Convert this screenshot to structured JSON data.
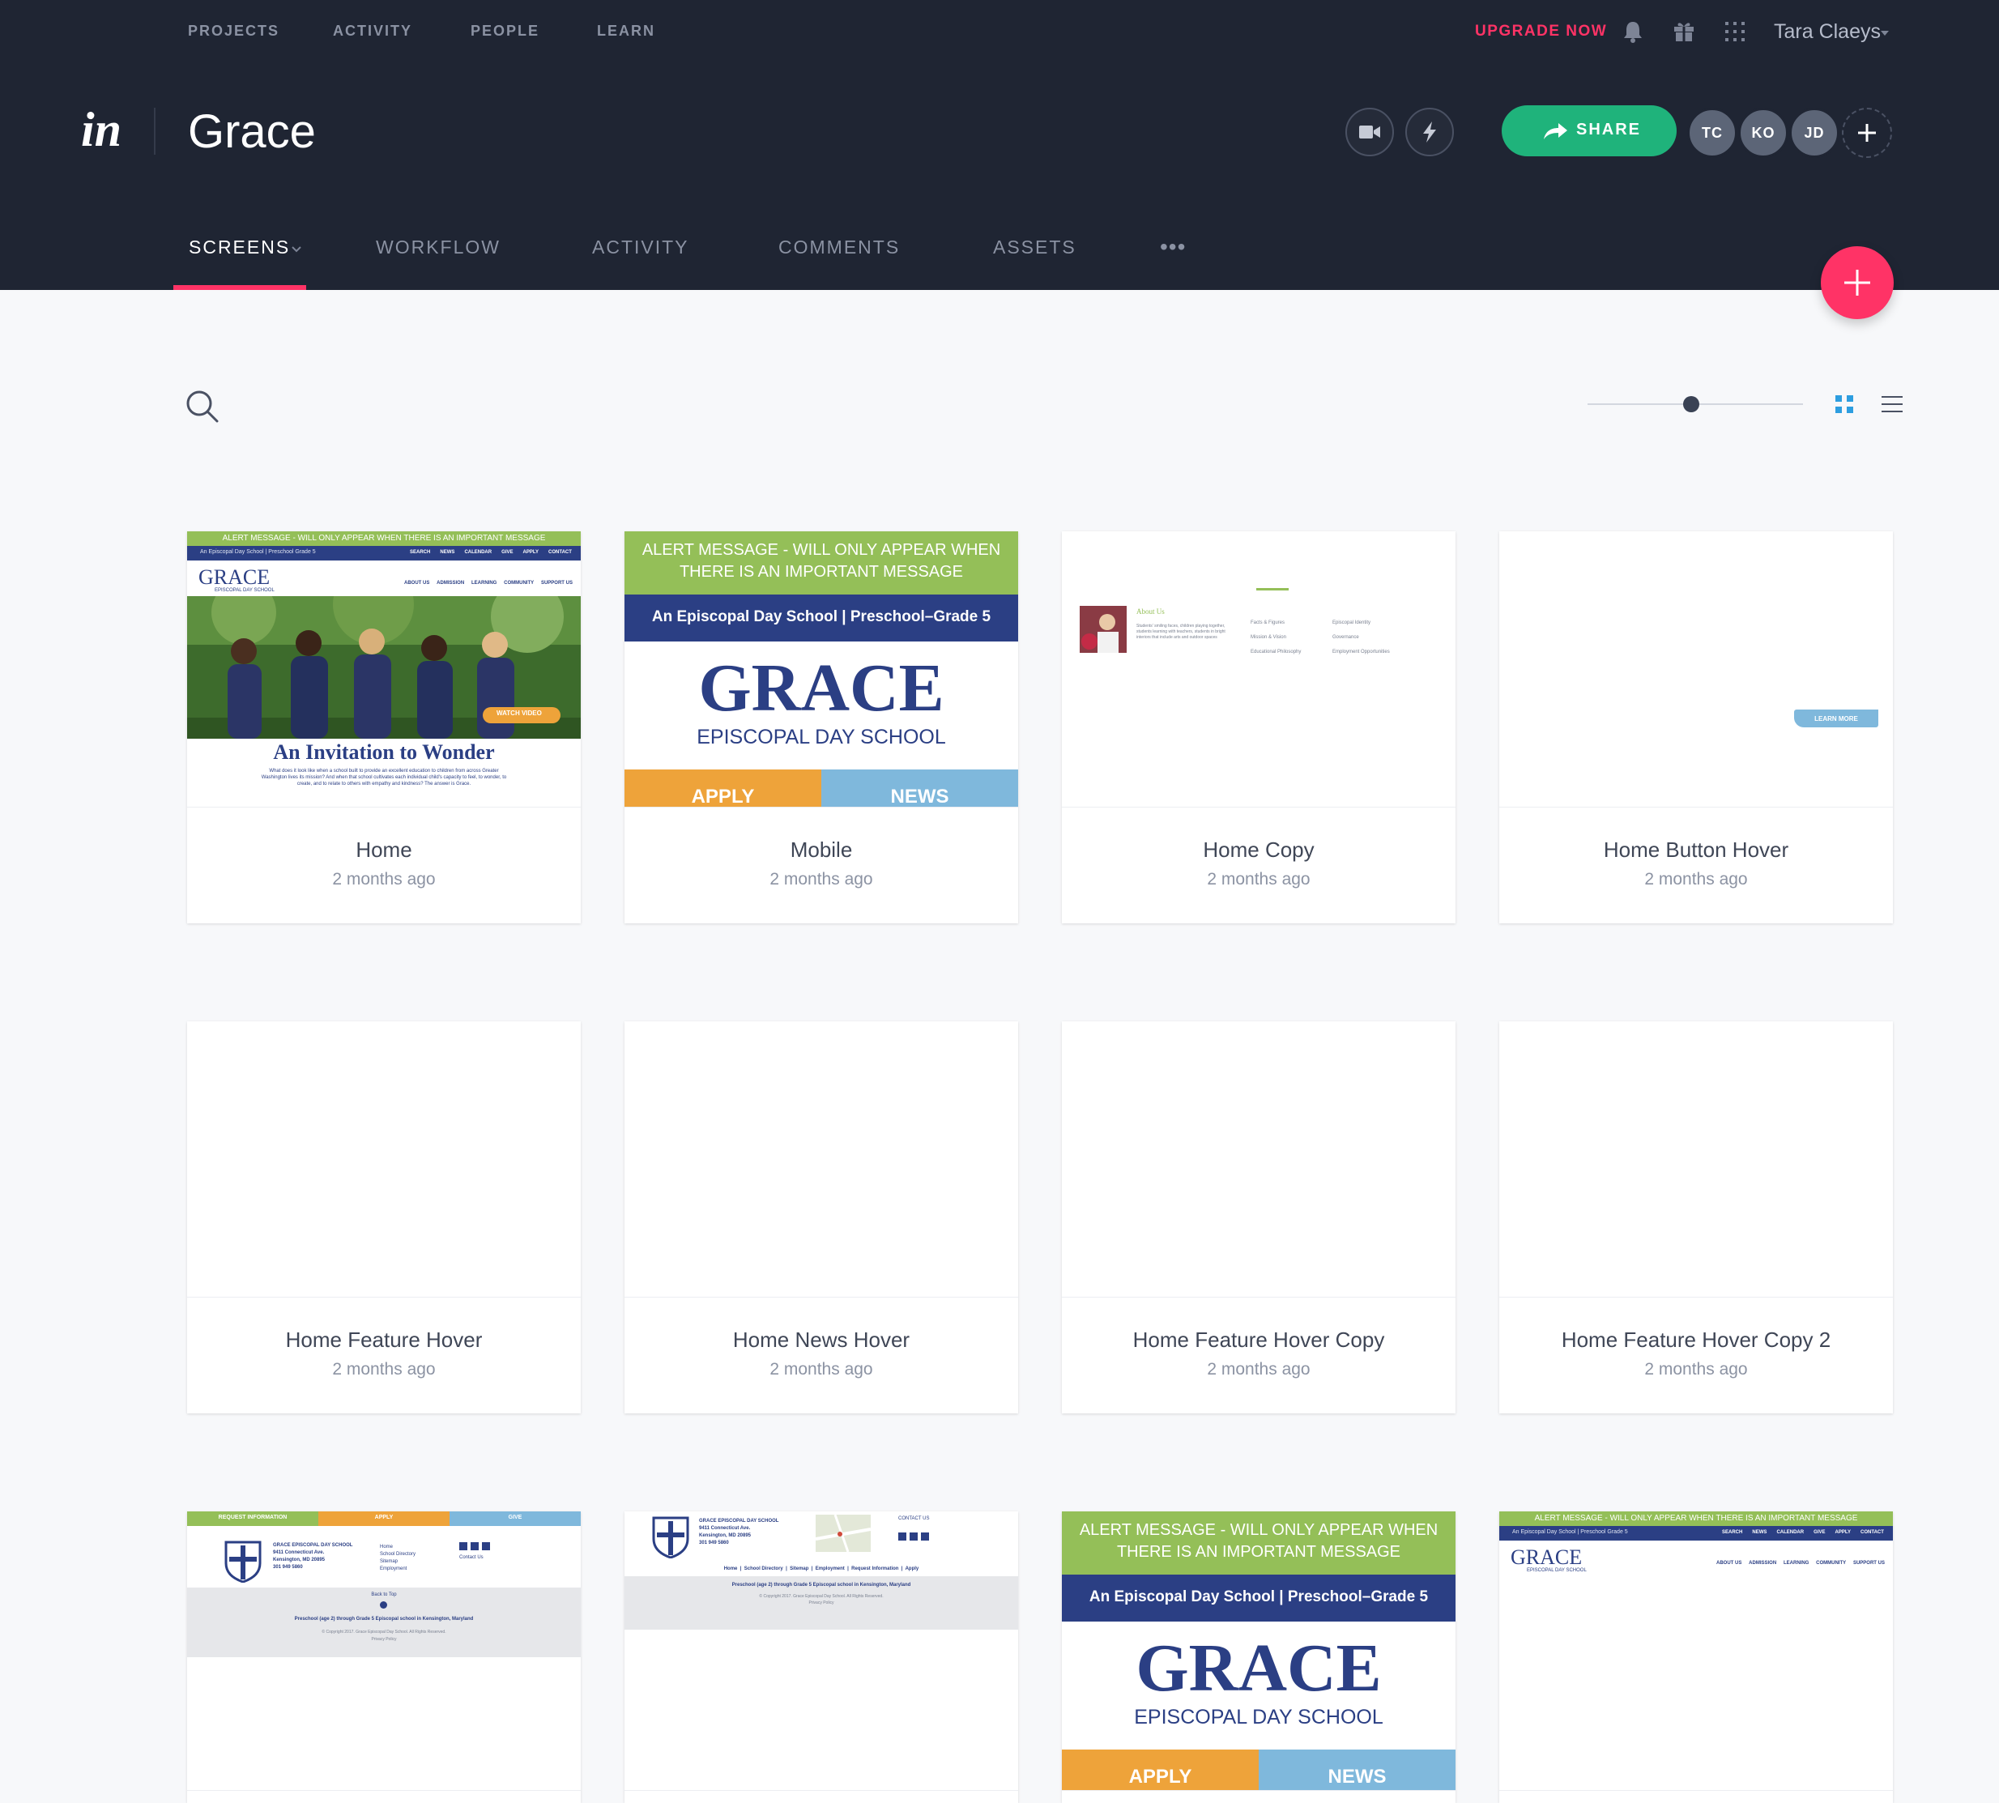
{
  "topnav": {
    "items": [
      "PROJECTS",
      "ACTIVITY",
      "PEOPLE",
      "LEARN"
    ],
    "upgrade": "UPGRADE NOW",
    "user": "Tara Claeys"
  },
  "project": {
    "logo": "in",
    "title": "Grace"
  },
  "share_label": "SHARE",
  "collaborators": [
    "TC",
    "KO",
    "JD"
  ],
  "tabs": [
    "SCREENS",
    "WORKFLOW",
    "ACTIVITY",
    "COMMENTS",
    "ASSETS"
  ],
  "tabs_more": "•••",
  "toolbar": {
    "zoom_level": 0.48,
    "active_view": "grid"
  },
  "screens": [
    {
      "name": "Home",
      "time": "2 months ago"
    },
    {
      "name": "Mobile",
      "time": "2 months ago"
    },
    {
      "name": "Home Copy",
      "time": "2 months ago"
    },
    {
      "name": "Home Button Hover",
      "time": "2 months ago"
    },
    {
      "name": "Home Feature Hover",
      "time": "2 months ago"
    },
    {
      "name": "Home News Hover",
      "time": "2 months ago"
    },
    {
      "name": "Home Feature Hover Copy",
      "time": "2 months ago"
    },
    {
      "name": "Home Feature Hover Copy 2",
      "time": "2 months ago"
    }
  ],
  "thumbs": {
    "alert_short": "ALERT MESSAGE - WILL ONLY APPEAR WHEN THERE IS AN IMPORTANT MESSAGE",
    "alert_line1": "ALERT MESSAGE - WILL ONLY APPEAR WHEN",
    "alert_line2": "THERE IS AN IMPORTANT MESSAGE",
    "tagline": "An Episcopal Day School | Preschool–Grade 5",
    "tagline_small": "An Episcopal Day School | Preschool Grade 5",
    "brand": "GRACE",
    "school": "EPISCOPAL DAY SCHOOL",
    "nav": [
      "SEARCH",
      "NEWS",
      "CALENDAR",
      "GIVE",
      "APPLY",
      "CONTACT"
    ],
    "menu": [
      "ABOUT US",
      "ADMISSION",
      "LEARNING",
      "COMMUNITY",
      "SUPPORT US"
    ],
    "watch_video": "WATCH VIDEO",
    "headline": "An Invitation to Wonder",
    "body": "What does it look like when a school built to provide an excellent education to children from across Greater Washington lives its mission? And when that school cultivates each individual child's capacity to feel, to wonder, to create, and to relate to others with empathy and kindness? The answer is Grace.",
    "apply": "APPLY",
    "news": "NEWS",
    "about_us": "About Us",
    "about_text": "Students' smiling faces, children playing together, students learning with teachers, students in bright interiors that include arts and outdoor spaces",
    "links_col1": [
      "Facts & Figures",
      "Mission & Vision",
      "Educational Philosophy"
    ],
    "links_col2": [
      "Episcopal Identity",
      "Governance",
      "Employment Opportunities"
    ],
    "learn_more": "LEARN MORE",
    "footer_bar": [
      "REQUEST INFORMATION",
      "APPLY",
      "GIVE"
    ],
    "address": [
      "GRACE EPISCOPAL DAY SCHOOL",
      "9411 Connecticut Ave.",
      "Kensington, MD 20895",
      "301 949 5860"
    ],
    "footer_links": [
      "Home",
      "School Directory",
      "Sitemap",
      "Employment"
    ],
    "contact_us": "Contact Us",
    "contact_caps": "CONTACT US",
    "back_to_top": "Back to Top",
    "footer_desc": "Preschool (age 2) through Grade 5 Episcopal school in Kensington, Maryland",
    "copyright": "© Copyright 2017. Grace Episcopal Day School. All Rights Reserved.",
    "privacy": "Privacy Policy",
    "footer_nav": "Home  |  School Directory  |  Sitemap  |  Employment  |  Request Information  |  Apply"
  },
  "colors": {
    "header": "#1f2533",
    "accent": "#ff3366",
    "share": "#1fb37b",
    "alert_green": "#94bf58",
    "navy": "#2b3f84",
    "apply_orange": "#eea33a",
    "news_blue": "#7fb8dc"
  }
}
